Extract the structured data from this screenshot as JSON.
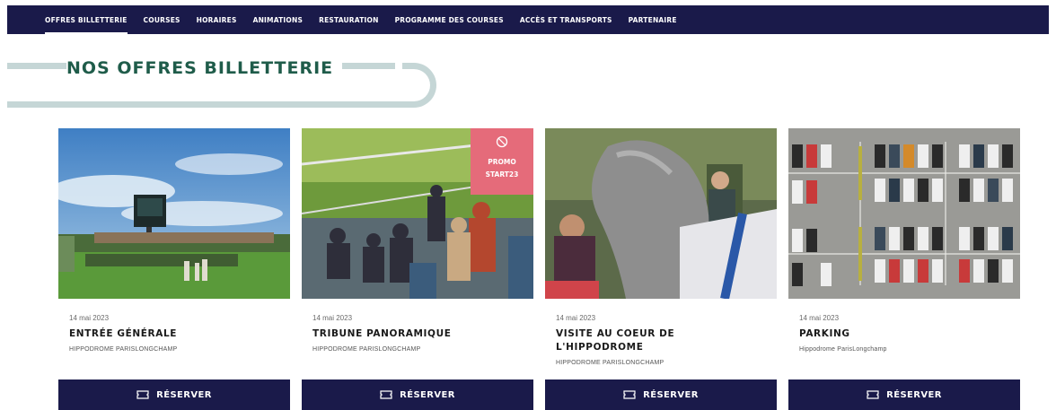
{
  "nav": {
    "items": [
      {
        "label": "OFFRES BILLETTERIE"
      },
      {
        "label": "COURSES"
      },
      {
        "label": "HORAIRES"
      },
      {
        "label": "ANIMATIONS"
      },
      {
        "label": "RESTAURATION"
      },
      {
        "label": "PROGRAMME DES COURSES"
      },
      {
        "label": "ACCÈS ET TRANSPORTS"
      },
      {
        "label": "PARTENAIRE"
      }
    ]
  },
  "section": {
    "title": "NOS OFFRES BILLETTERIE"
  },
  "cards": [
    {
      "date": "14 mai 2023",
      "title": "ENTRÉE GÉNÉRALE",
      "venue": "HIPPODROME PARISLONGCHAMP",
      "button": "RÉSERVER"
    },
    {
      "date": "14 mai 2023",
      "title": "TRIBUNE PANORAMIQUE",
      "venue": "HIPPODROME PARISLONGCHAMP",
      "button": "RÉSERVER",
      "promo": {
        "line1": "PROMO",
        "line2": "START23"
      }
    },
    {
      "date": "14 mai 2023",
      "title": "VISITE AU COEUR DE L'HIPPODROME",
      "venue": "HIPPODROME PARISLONGCHAMP",
      "button": "RÉSERVER"
    },
    {
      "date": "14 mai 2023",
      "title": "PARKING",
      "venue": "Hippodrome ParisLongchamp",
      "button": "RÉSERVER"
    }
  ],
  "colors": {
    "nav_bg": "#1a1a4a",
    "heading_text": "#1f5c4a",
    "heading_pill": "#c5d6d6",
    "button_bg": "#1a1a4a",
    "promo_bg": "#e56b7a"
  },
  "icons": {
    "button": "ticket-icon",
    "promo": "no-sign-icon"
  }
}
